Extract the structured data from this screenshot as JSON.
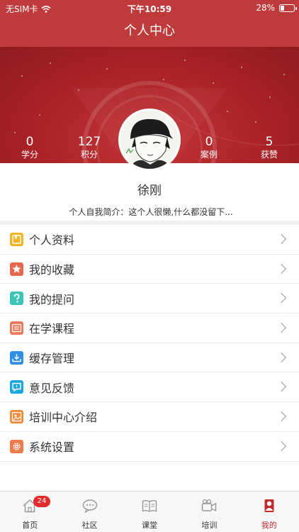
{
  "status_bar": {
    "carrier": "无SIM卡",
    "time": "下午10:59",
    "battery": "28%",
    "battery_level": 0.28
  },
  "nav": {
    "title": "个人中心"
  },
  "stats": [
    {
      "value": "0",
      "label": "学分"
    },
    {
      "value": "127",
      "label": "积分"
    },
    {
      "value": "0",
      "label": "案例"
    },
    {
      "value": "5",
      "label": "获赞"
    }
  ],
  "profile": {
    "name": "徐刚",
    "intro_label": "个人自我简介：",
    "intro_text": "这个人很懒,什么都没留下..."
  },
  "menu": [
    {
      "label": "个人资料",
      "icon": "profile-icon",
      "color": "#f0b428"
    },
    {
      "label": "我的收藏",
      "icon": "star-icon",
      "color": "#e4694d"
    },
    {
      "label": "我的提问",
      "icon": "question-icon",
      "color": "#3cc4b8"
    },
    {
      "label": "在学课程",
      "icon": "course-icon",
      "color": "#ea7a5a"
    },
    {
      "label": "缓存管理",
      "icon": "download-icon",
      "color": "#2f8fe6"
    },
    {
      "label": "意见反馈",
      "icon": "feedback-icon",
      "color": "#1aa7e0"
    },
    {
      "label": "培训中心介绍",
      "icon": "training-center-icon",
      "color": "#f08a3a"
    },
    {
      "label": "系统设置",
      "icon": "gear-icon",
      "color": "#ef7b4a"
    }
  ],
  "tabbar": {
    "badge": "24",
    "items": [
      {
        "label": "首页",
        "icon": "home-icon"
      },
      {
        "label": "社区",
        "icon": "chat-icon"
      },
      {
        "label": "课堂",
        "icon": "book-icon"
      },
      {
        "label": "培训",
        "icon": "video-icon"
      },
      {
        "label": "我的",
        "icon": "user-icon"
      }
    ],
    "active_index": 4
  },
  "colors": {
    "brand_red": "#bf3a3a",
    "header_red": "#a92226",
    "active_tab": "#c12b2b"
  }
}
